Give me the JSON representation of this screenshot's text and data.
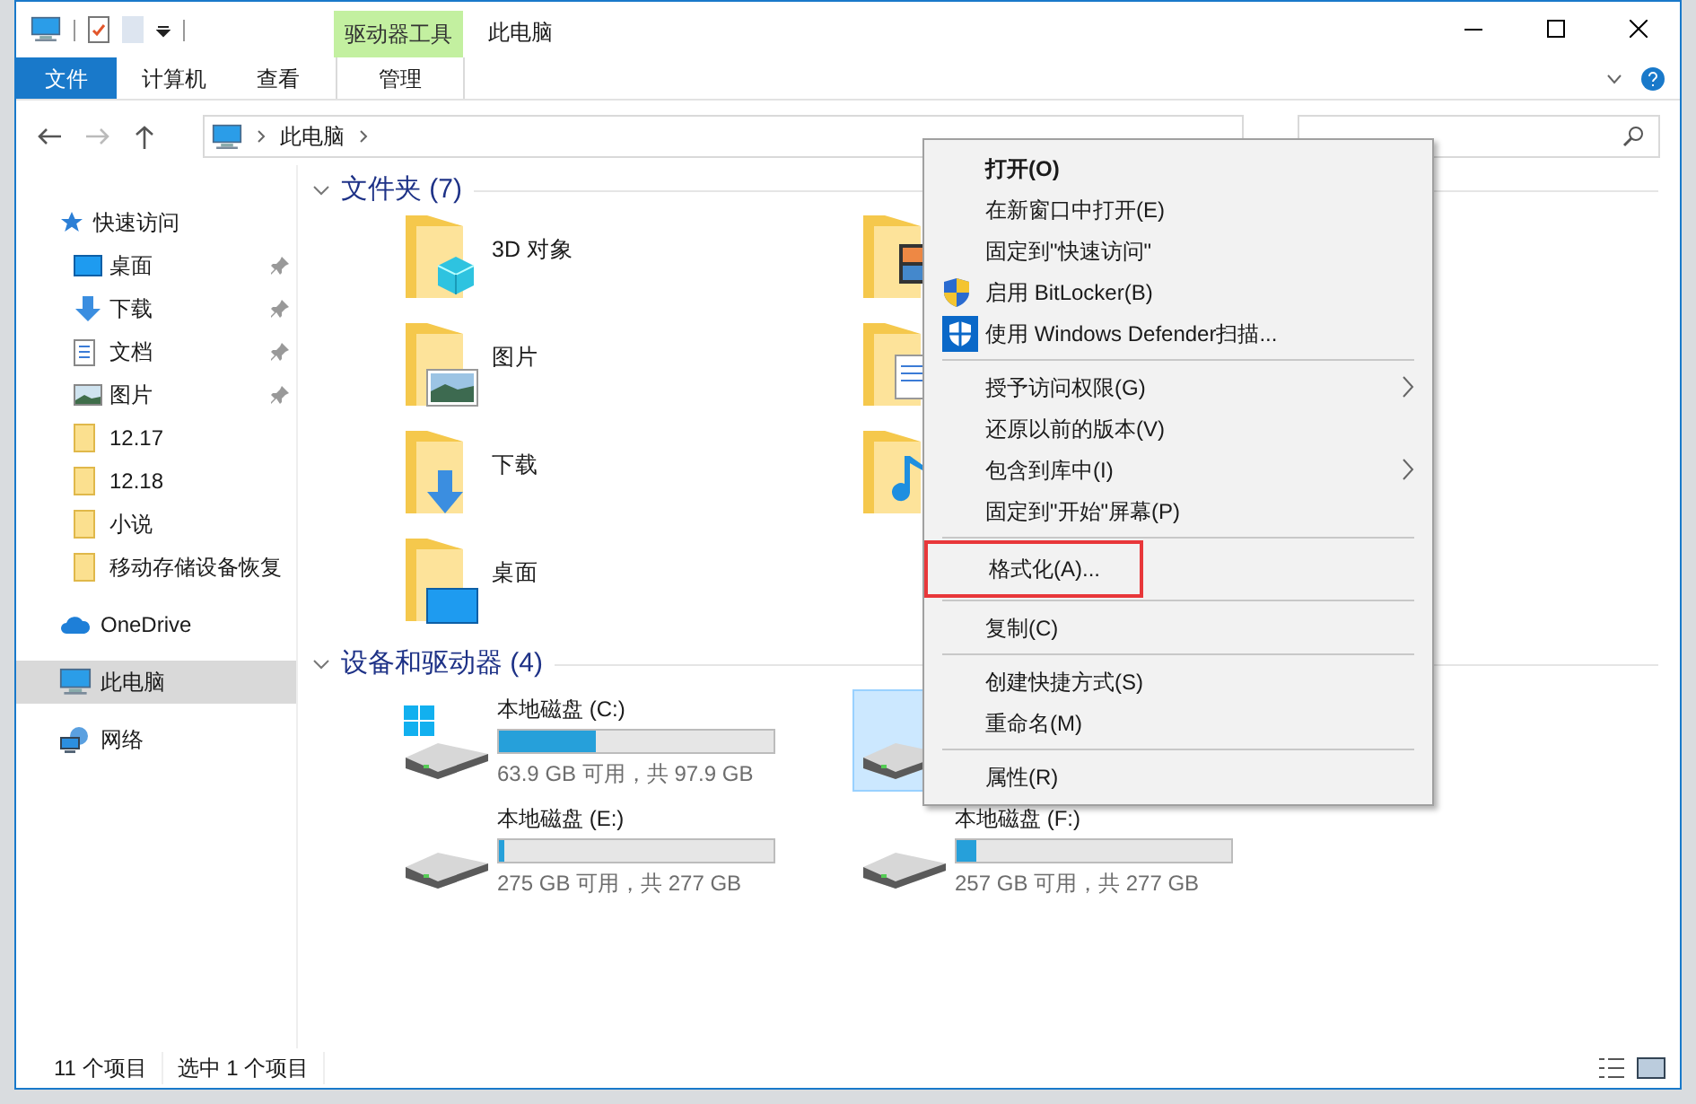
{
  "window": {
    "title": "此电脑",
    "context_tab": "驱动器工具"
  },
  "ribbon_tabs": [
    {
      "label": "文件",
      "kind": "file",
      "selected": false
    },
    {
      "label": "计算机",
      "kind": "tab",
      "selected": false
    },
    {
      "label": "查看",
      "kind": "tab",
      "selected": false
    },
    {
      "label": "管理",
      "kind": "context",
      "selected": false
    }
  ],
  "address": {
    "path": "此电脑"
  },
  "sidebar": {
    "items": [
      {
        "label": "快速访问",
        "kind": "star",
        "selected": false,
        "children": [
          {
            "label": "桌面",
            "kind": "desktop",
            "pinned": true,
            "selected": false
          },
          {
            "label": "下载",
            "kind": "download",
            "pinned": true,
            "selected": false
          },
          {
            "label": "文档",
            "kind": "document",
            "pinned": true,
            "selected": false
          },
          {
            "label": "图片",
            "kind": "picture",
            "pinned": true,
            "selected": false
          },
          {
            "label": "12.17",
            "kind": "folder",
            "pinned": false,
            "selected": false
          },
          {
            "label": "12.18",
            "kind": "folder",
            "pinned": false,
            "selected": false
          },
          {
            "label": "小说",
            "kind": "folder",
            "pinned": false,
            "selected": false
          },
          {
            "label": "移动存储设备恢复 ",
            "kind": "folder",
            "pinned": false,
            "selected": false
          }
        ]
      },
      {
        "label": "OneDrive",
        "kind": "cloud",
        "selected": false
      },
      {
        "label": "此电脑",
        "kind": "pc",
        "selected": true
      },
      {
        "label": "网络",
        "kind": "network",
        "selected": false
      }
    ]
  },
  "folders": {
    "heading": "文件夹 (7)",
    "items": [
      {
        "name": "3D 对象",
        "kind": "cube"
      },
      {
        "kind": "video"
      },
      {
        "name": "图片",
        "kind": "pictures"
      },
      {
        "kind": "documents"
      },
      {
        "name": "下载",
        "kind": "downloads"
      },
      {
        "kind": "music"
      },
      {
        "name": "桌面",
        "kind": "desktop"
      }
    ]
  },
  "drives": {
    "heading": "设备和驱动器 (4)",
    "items": [
      {
        "name": "本地磁盘 (C:)",
        "kind": "system",
        "level": 0.35,
        "space": "63.9 GB 可用，共 97.9 GB",
        "selected": false
      },
      {
        "kind": "disk",
        "selected": true
      },
      {
        "name": "本地磁盘 (E:)",
        "kind": "disk",
        "level": 0.02,
        "space": "275 GB 可用，共 277 GB",
        "selected": false
      },
      {
        "name": "本地磁盘 (F:)",
        "kind": "disk",
        "level": 0.07,
        "space": "257 GB 可用，共 277 GB",
        "selected": false
      }
    ]
  },
  "context_menu": {
    "items": [
      {
        "label": "打开(O)",
        "kind": "default",
        "highlighted": false
      },
      {
        "label": "在新窗口中打开(E)",
        "kind": "plain",
        "highlighted": false
      },
      {
        "label": "固定到\"快速访问\"",
        "kind": "plain",
        "highlighted": false
      },
      {
        "label": "启用 BitLocker(B)",
        "kind": "shield",
        "highlighted": false
      },
      {
        "label": "使用 Windows Defender扫描...",
        "kind": "defender",
        "highlighted": false
      },
      {
        "kind": "separator"
      },
      {
        "label": "授予访问权限(G)",
        "kind": "submenu",
        "highlighted": false
      },
      {
        "label": "还原以前的版本(V)",
        "kind": "plain",
        "highlighted": false
      },
      {
        "label": "包含到库中(I)",
        "kind": "submenu",
        "highlighted": false
      },
      {
        "label": "固定到\"开始\"屏幕(P)",
        "kind": "plain",
        "highlighted": false
      },
      {
        "kind": "separator"
      },
      {
        "label": "格式化(A)...",
        "kind": "plain",
        "highlighted": true
      },
      {
        "kind": "separator"
      },
      {
        "label": "复制(C)",
        "kind": "plain",
        "highlighted": false
      },
      {
        "kind": "separator"
      },
      {
        "label": "创建快捷方式(S)",
        "kind": "plain",
        "highlighted": false
      },
      {
        "label": "重命名(M)",
        "kind": "plain",
        "highlighted": false
      },
      {
        "kind": "separator"
      },
      {
        "label": "属性(R)",
        "kind": "plain",
        "highlighted": false
      }
    ]
  },
  "status_bar": {
    "items": [
      "11 个项目",
      "选中 1 个项目"
    ]
  }
}
